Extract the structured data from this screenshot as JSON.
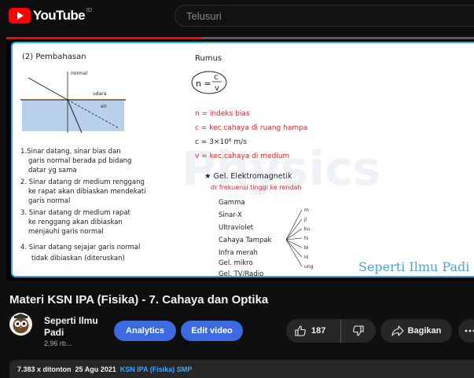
{
  "header": {
    "brand": "YouTube",
    "region": "ID",
    "search_placeholder": "Telusuri"
  },
  "player": {
    "progress_fraction": 0.42,
    "board": {
      "section": "(2) Pembahasan",
      "diagram_labels": {
        "normal": "normal",
        "medium_top": "udara",
        "medium_bottom": "air"
      },
      "notes": [
        "1.Sinar datang, sinar bias dan",
        "garis normal berada pd bidang",
        "datar yg sama",
        "2. Sinar datang dr medium renggang",
        "ke rapat akan dibiaskan mendekati",
        "garis normal",
        "3. Sinar datang dr medium rapat",
        "ke renggang akan dibiaskan",
        "menjauhi garis normal",
        "4. Sinar datang sejajar garis normal",
        "tidak dibiaskan (diteruskan)"
      ],
      "rumus_title": "Rumus",
      "formula_lhs": "n =",
      "formula_num": "c",
      "formula_den": "v",
      "definitions": [
        "n = indeks bias",
        "c = kec.cahaya di ruang hampa",
        "c = 3×10⁸ m/s",
        "v = kec.cahaya di medium"
      ],
      "em_title": "★ Gel. Elektromagnetik",
      "em_subtitle": "dr frekuensi tinggi ke rendah",
      "spectrum": [
        "Gamma",
        "Sinar-X",
        "Ultraviolet",
        "Cahaya Tampak",
        "Infra merah",
        "Gel. mikro",
        "Gel. TV/Radio"
      ],
      "visible_colors": [
        "m",
        "ji",
        "ku",
        "hi",
        "bi",
        "ni",
        "ung"
      ],
      "watermark_bg": "Physics",
      "watermark": "Seperti Ilmu Padi"
    }
  },
  "video": {
    "title": "Materi KSN IPA (Fisika) - 7. Cahaya dan Optika"
  },
  "channel": {
    "name": "Seperti Ilmu Padi",
    "subscribers": "2,96 rb..."
  },
  "actions": {
    "analytics": "Analytics",
    "edit": "Edit video",
    "likes": "187",
    "share": "Bagikan"
  },
  "description": {
    "views": "7.383 x ditonton",
    "date": "25 Agu 2021",
    "tag": "KSN IPA (Fisika) SMP"
  },
  "colors": {
    "accent_red": "#ff0000",
    "button_blue": "#3e6ae1",
    "link_blue": "#3ea6ff",
    "board_border": "#2fb0e6",
    "ink_red": "#d8262b"
  }
}
